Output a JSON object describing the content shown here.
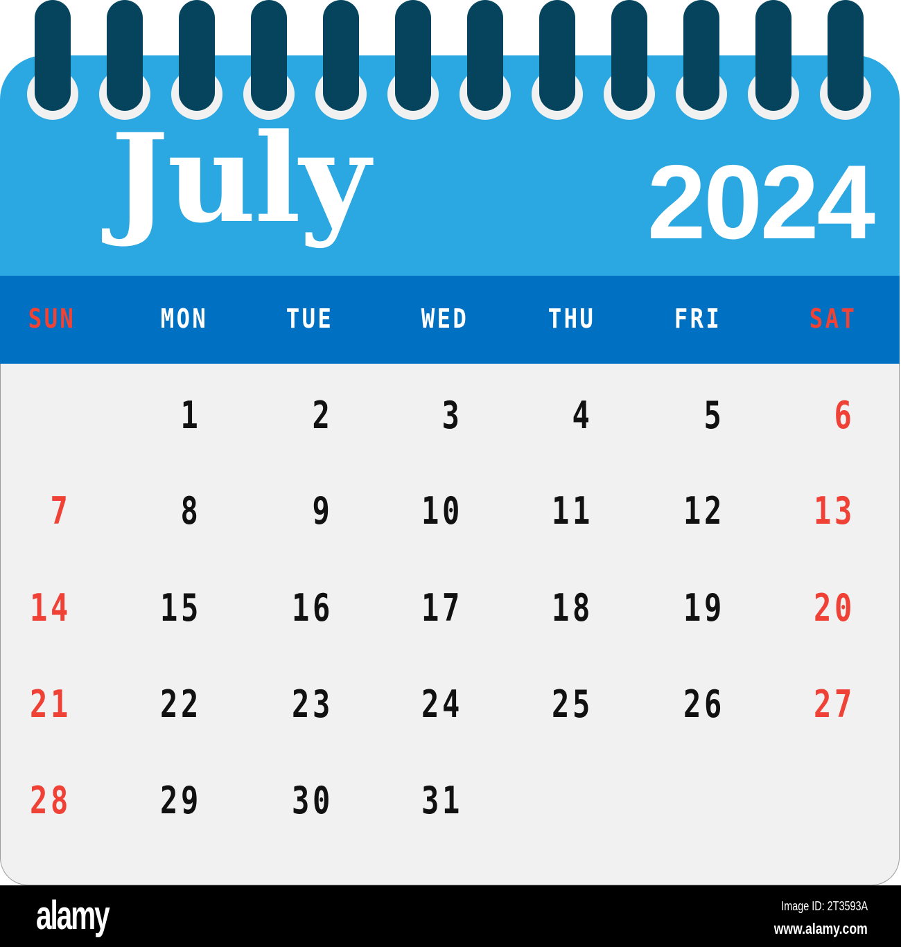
{
  "calendar": {
    "month": "July",
    "year": "2024",
    "ring_count": 12,
    "weekdays": [
      {
        "label": "SUN",
        "weekend": true
      },
      {
        "label": "MON",
        "weekend": false
      },
      {
        "label": "TUE",
        "weekend": false
      },
      {
        "label": "WED",
        "weekend": false
      },
      {
        "label": "THU",
        "weekend": false
      },
      {
        "label": "FRI",
        "weekend": false
      },
      {
        "label": "SAT",
        "weekend": true
      }
    ],
    "weeks": [
      [
        "",
        "1",
        "2",
        "3",
        "4",
        "5",
        "6"
      ],
      [
        "7",
        "8",
        "9",
        "10",
        "11",
        "12",
        "13"
      ],
      [
        "14",
        "15",
        "16",
        "17",
        "18",
        "19",
        "20"
      ],
      [
        "21",
        "22",
        "23",
        "24",
        "25",
        "26",
        "27"
      ],
      [
        "28",
        "29",
        "30",
        "31",
        "",
        "",
        ""
      ]
    ]
  },
  "colors": {
    "header": "#2BA7E1",
    "weekday_bar": "#0071C2",
    "rings": "#06445E",
    "weekend": "#EF4136",
    "body": "#F1F1F1"
  },
  "footer": {
    "logo": "alamy",
    "image_id": "Image ID: 2T3593A",
    "site": "www.alamy.com"
  }
}
